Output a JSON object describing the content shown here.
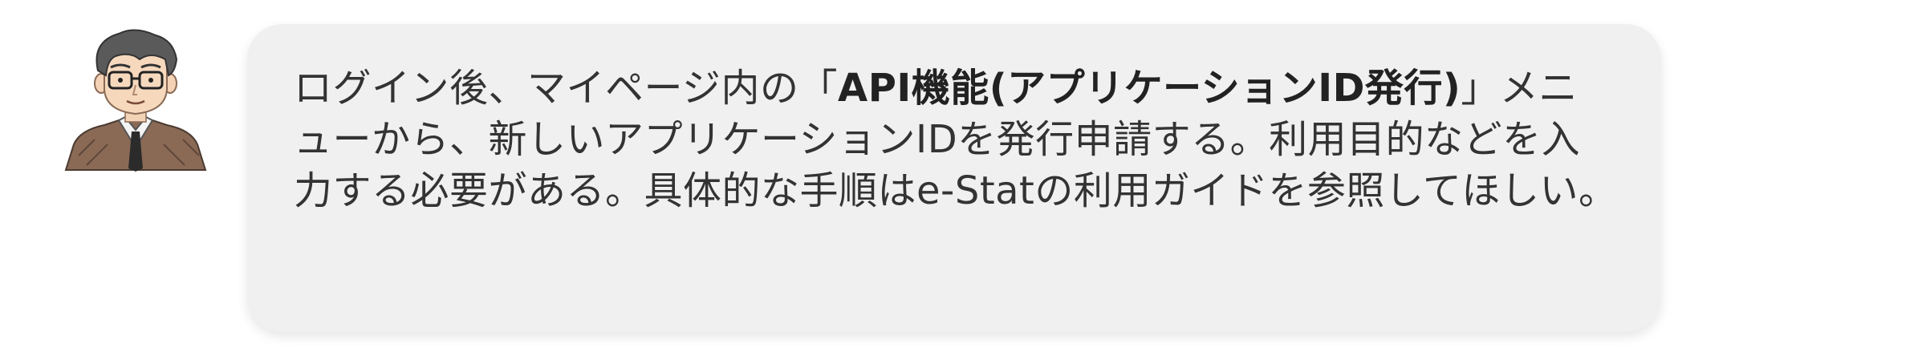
{
  "chat": {
    "avatar_icon": "male-teacher-avatar-icon",
    "message": {
      "line1_before": "ログイン後、マイページ内の「",
      "line1_bold": "API機能(アプリケーションID発行)",
      "line1_after": "」メニ",
      "line2": "ューから、新しいアプリケーションIDを発行申請する。利用目的などを入",
      "line3": "力する必要がある。具体的な手順はe-Statの利用ガイドを参照してほしい。"
    },
    "colors": {
      "bubble_bg": "#f0f0f0",
      "text": "#333333"
    }
  }
}
